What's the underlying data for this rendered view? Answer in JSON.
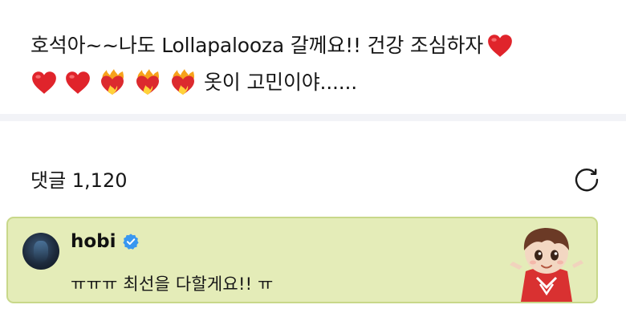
{
  "post": {
    "line1_text": "호석아~~나도 Lollapalooza 갈께요!! 건강 조심하자",
    "line2_text": "옷이 고민이야......",
    "heart_icon": "red-heart-icon",
    "fire_heart_icon": "heart-on-fire-icon"
  },
  "comments": {
    "count_label": "댓글 1,120",
    "refresh_icon": "refresh-icon"
  },
  "comment": {
    "author": "hobi",
    "verified_icon": "verified-badge-icon",
    "text": "ㅠㅠㅠ 최선을 다할게요!! ㅠ",
    "sticker_icon": "character-sticker-icon",
    "highlight_color": "#e4ecb8"
  }
}
